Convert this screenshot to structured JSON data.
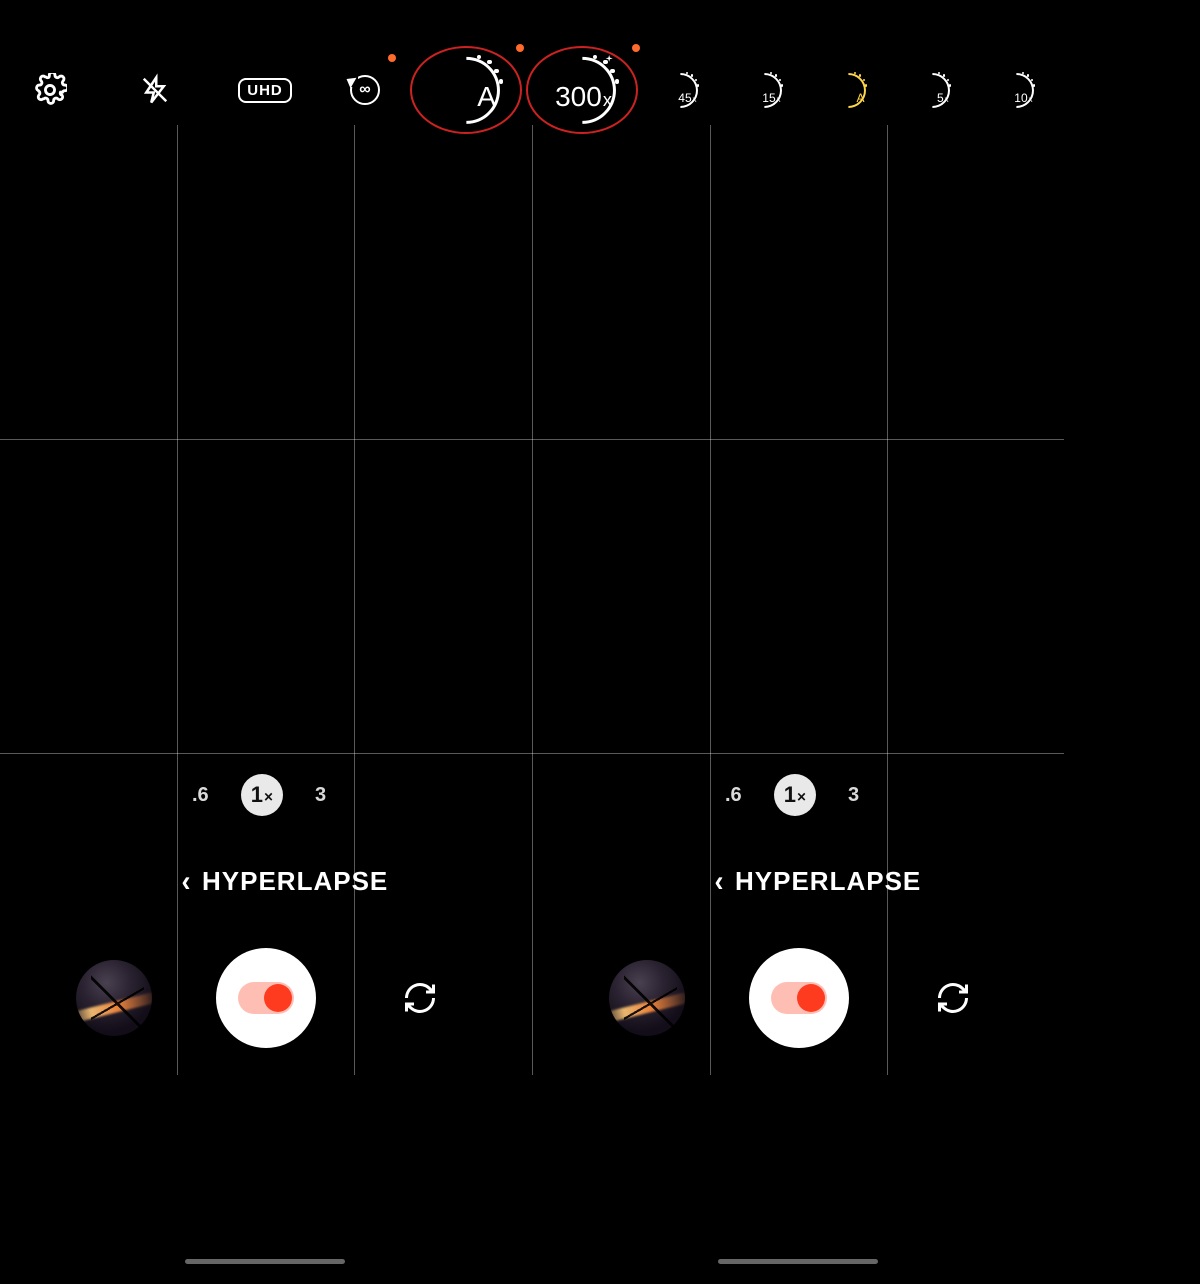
{
  "toolbar": {
    "settings": "settings",
    "flash": "flash-off",
    "quality": "UHD",
    "timer": {
      "label": "∞"
    },
    "circled": [
      {
        "id": "speed-auto",
        "label": "A",
        "notif": true,
        "sparkle": false,
        "highlight": false
      },
      {
        "id": "speed-300x",
        "label": "300",
        "notif": true,
        "sparkle": true,
        "highlight": false
      }
    ],
    "speeds": [
      {
        "id": "speed-45x",
        "label": "45",
        "highlight": false
      },
      {
        "id": "speed-15x",
        "label": "15",
        "highlight": false
      },
      {
        "id": "speed-auto-2",
        "label": "A",
        "highlight": true
      },
      {
        "id": "speed-5x",
        "label": "5",
        "highlight": false
      },
      {
        "id": "speed-10x",
        "label": "10",
        "highlight": false
      }
    ]
  },
  "panes": [
    {
      "zoom": {
        "options": [
          ".6",
          "1",
          "3"
        ],
        "selected": "1"
      },
      "mode": "HYPERLAPSE",
      "shutter": "record",
      "switch": "switch-camera",
      "thumb": "gallery"
    },
    {
      "zoom": {
        "options": [
          ".6",
          "1",
          "3"
        ],
        "selected": "1"
      },
      "mode": "HYPERLAPSE",
      "shutter": "record",
      "switch": "switch-camera",
      "thumb": "gallery"
    }
  ],
  "grid": {
    "vlines": [
      177,
      354,
      532,
      710,
      887,
      1064
    ],
    "hlines": [
      314,
      628
    ]
  },
  "colors": {
    "circle": "#c22",
    "notif": "#ff6b2d",
    "highlight": "#ffd54a",
    "record": "#ff3b1f"
  }
}
